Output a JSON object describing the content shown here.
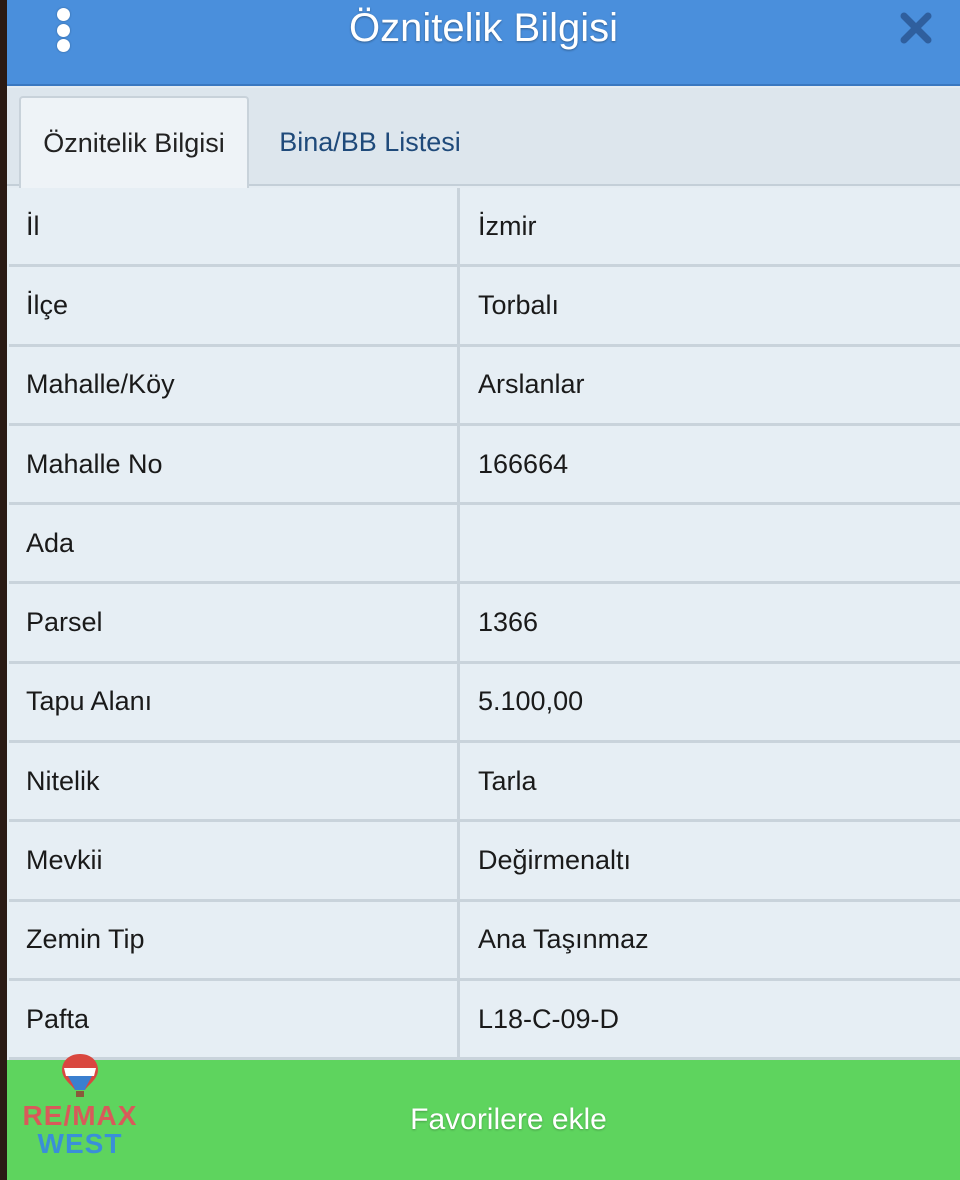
{
  "header": {
    "title": "Öznitelik Bilgisi",
    "menu_icon": "vertical-dots-icon",
    "close_icon": "close-icon"
  },
  "tabs": [
    {
      "label": "Öznitelik Bilgisi",
      "active": true
    },
    {
      "label": "Bina/BB Listesi",
      "active": false
    }
  ],
  "rows": [
    {
      "label": "İl",
      "value": "İzmir"
    },
    {
      "label": "İlçe",
      "value": "Torbalı"
    },
    {
      "label": "Mahalle/Köy",
      "value": "Arslanlar"
    },
    {
      "label": "Mahalle No",
      "value": "166664"
    },
    {
      "label": "Ada",
      "value": ""
    },
    {
      "label": "Parsel",
      "value": "1366"
    },
    {
      "label": "Tapu Alanı",
      "value": "5.100,00"
    },
    {
      "label": "Nitelik",
      "value": "Tarla"
    },
    {
      "label": "Mevkii",
      "value": "Değirmenaltı"
    },
    {
      "label": "Zemin Tip",
      "value": "Ana Taşınmaz"
    },
    {
      "label": "Pafta",
      "value": "L18-C-09-D"
    }
  ],
  "footer": {
    "button_label": "Favorilere ekle"
  },
  "logo": {
    "line1": "RE/MAX",
    "line2": "WEST",
    "balloon_text": "RE/MAX"
  },
  "colors": {
    "header": "#4a8fdc",
    "footer": "#5ed45e",
    "tab_inactive_text": "#1f4a7a"
  }
}
